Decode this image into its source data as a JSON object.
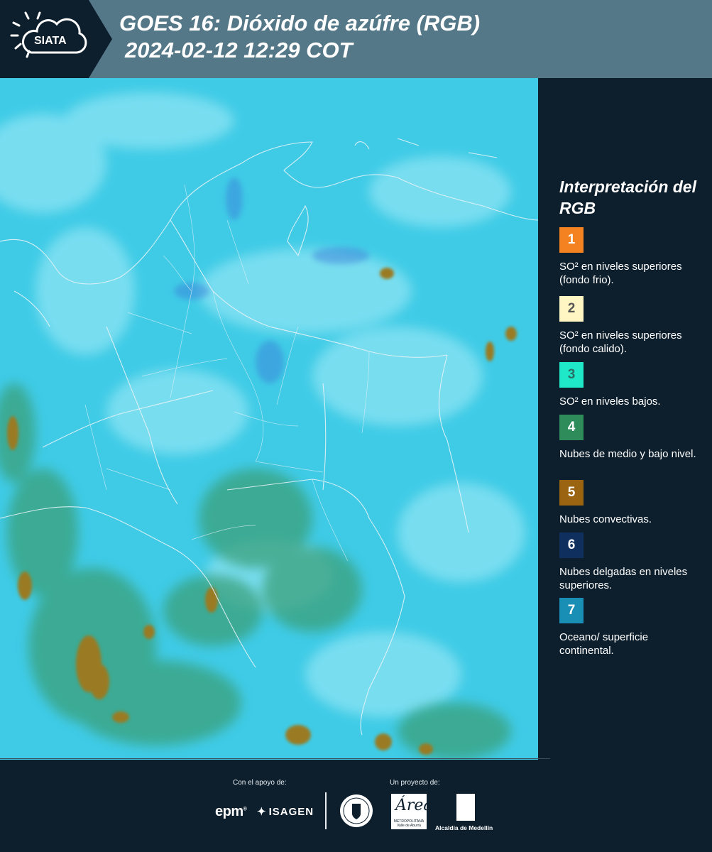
{
  "header": {
    "logo_text": "SIATA",
    "title_line1": "GOES 16: Dióxido de azúfre (RGB)",
    "title_line2": "2024-02-12 12:29 COT"
  },
  "legend": {
    "title": "Interpretación del RGB",
    "items": [
      {
        "number": "1",
        "label": "SO² en niveles superiores (fondo frio).",
        "color": "#f58220",
        "text_color": "#ffffff"
      },
      {
        "number": "2",
        "label": "SO² en niveles superiores (fondo calido).",
        "color": "#fff6c4",
        "text_color": "#555555"
      },
      {
        "number": "3",
        "label": "SO² en niveles bajos.",
        "color": "#1ee8c8",
        "text_color": "#2a6f66"
      },
      {
        "number": "4",
        "label": "Nubes de medio y bajo nivel.",
        "color": "#2e8b5a",
        "text_color": "#ffffff"
      },
      {
        "number": "5",
        "label": "Nubes convectivas.",
        "color": "#9a6410",
        "text_color": "#ffffff"
      },
      {
        "number": "6",
        "label": "Nubes delgadas en niveles superiores.",
        "color": "#0f2f5e",
        "text_color": "#ffffff"
      },
      {
        "number": "7",
        "label": "Oceano/ superficie continental.",
        "color": "#1a8fb5",
        "text_color": "#ffffff"
      }
    ]
  },
  "footer": {
    "support_label": "Con el apoyo de:",
    "project_label": "Un proyecto de:",
    "sponsors": [
      "epm",
      "ISAGEN"
    ],
    "partners": {
      "area_script": "Área",
      "area_sub": "METROPOLITANA Valle de Aburrá",
      "alcaldia": "Alcaldía de Medellín"
    }
  },
  "map": {
    "base_color": "#36c9e4",
    "cloud_color": "#9ee9f6",
    "convective_color": "#9a7a22",
    "green_cloud_color": "#3aa07a",
    "border_color": "#e6f2f6"
  }
}
